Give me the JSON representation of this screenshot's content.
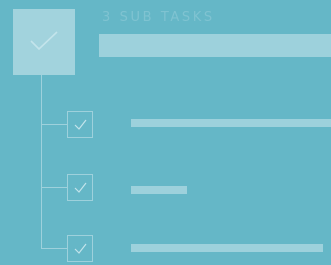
{
  "header": {
    "title": "3 SUB TASKS",
    "parent_task": {
      "checked": true,
      "text": ""
    }
  },
  "subtasks": [
    {
      "checked": true,
      "text": ""
    },
    {
      "checked": true,
      "text": ""
    },
    {
      "checked": true,
      "text": ""
    }
  ],
  "colors": {
    "background": "#65b7c7",
    "primary_block": "#a2d3dd",
    "line": "#9ed1dc",
    "title_text": "#7fc3d1"
  },
  "icons": {
    "check": "check-icon"
  }
}
